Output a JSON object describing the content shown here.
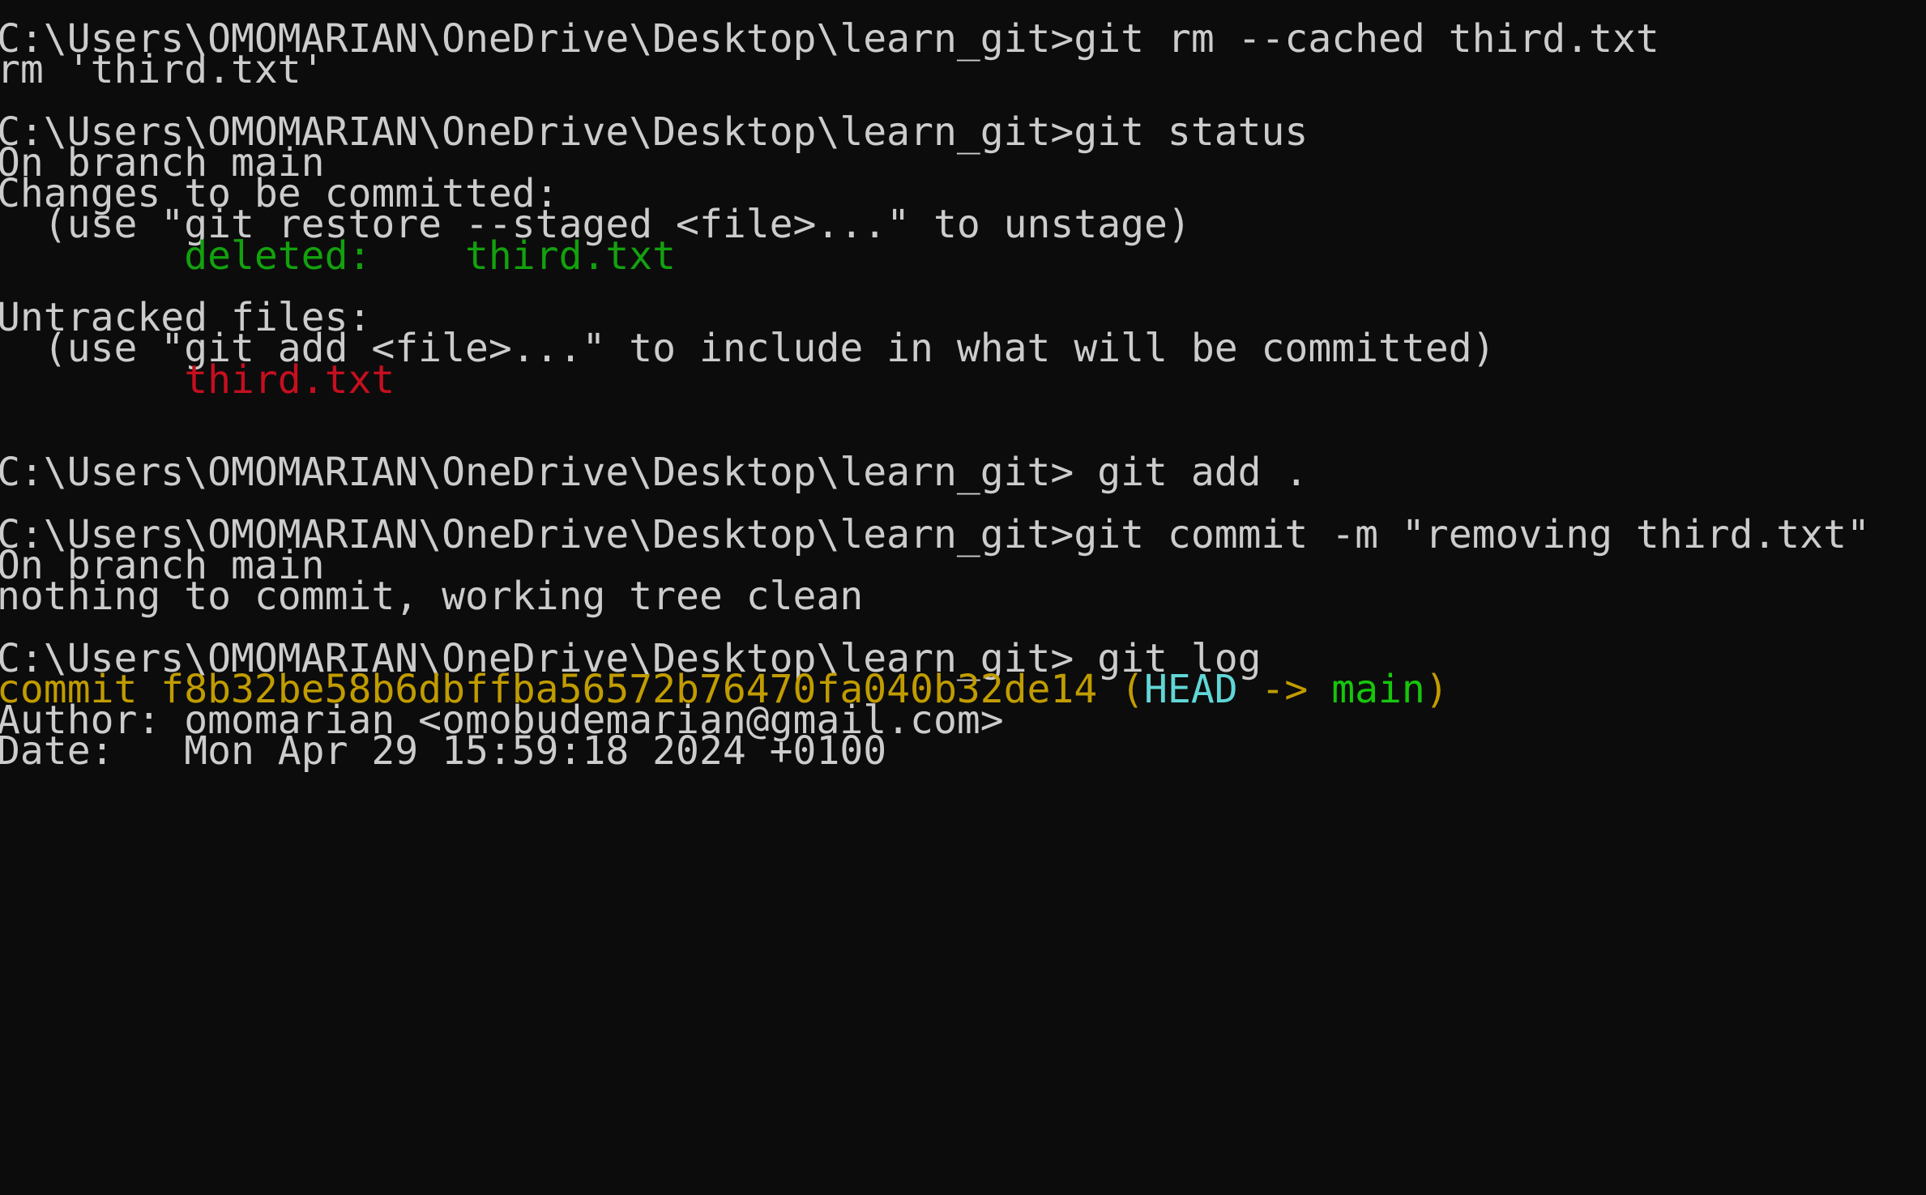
{
  "terminal": {
    "lines": [
      "C:\\Users\\OMOMARIAN\\OneDrive\\Desktop\\learn_git>git rm --cached third.txt",
      "rm 'third.txt'",
      "",
      "C:\\Users\\OMOMARIAN\\OneDrive\\Desktop\\learn_git>git status",
      "On branch main",
      "Changes to be committed:",
      "  (use \"git restore --staged <file>...\" to unstage)",
      "        ",
      "deleted:    third.txt",
      "",
      "Untracked files:",
      "  (use \"git add <file>...\" to include in what will be committed)",
      "        ",
      "third.txt",
      "",
      "",
      "C:\\Users\\OMOMARIAN\\OneDrive\\Desktop\\learn_git> git add .",
      "",
      "C:\\Users\\OMOMARIAN\\OneDrive\\Desktop\\learn_git>git commit -m \"removing third.txt\"",
      "On branch main",
      "nothing to commit, working tree clean",
      "",
      "C:\\Users\\OMOMARIAN\\OneDrive\\Desktop\\learn_git> git log",
      "commit f8b32be58b6dbffba56572b76470fa040b32de14 (",
      "HEAD",
      " -> ",
      "main",
      ")",
      "Author: omomarian <omobudemarian@gmail.com>",
      "Date:   Mon Apr 29 15:59:18 2024 +0100"
    ]
  },
  "colors": {
    "background": "#0c0c0c",
    "foreground": "#cccccc",
    "staged_green": "#13a10e",
    "untracked_red": "#c50f1f",
    "commit_yellow": "#c19c00",
    "head_cyan": "#61d6d6",
    "branch_green": "#16c60c"
  }
}
